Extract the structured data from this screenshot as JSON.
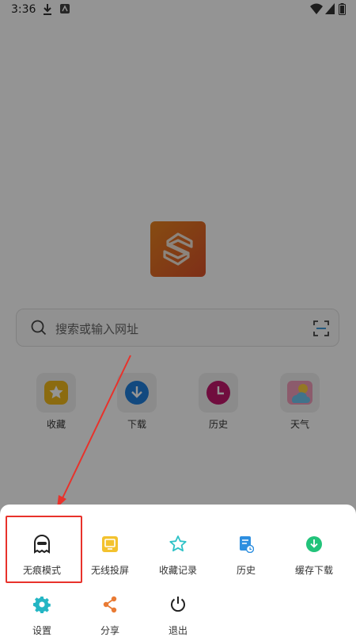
{
  "status_bar": {
    "time": "3:36"
  },
  "search": {
    "placeholder": "搜索或输入网址"
  },
  "shortcuts": [
    {
      "label": "收藏",
      "icon": "star-icon",
      "color": "#f0b81d"
    },
    {
      "label": "下载",
      "icon": "download-icon",
      "color": "#1f7fdb"
    },
    {
      "label": "历史",
      "icon": "clock-icon",
      "color": "#c2186c"
    },
    {
      "label": "天气",
      "icon": "weather-icon",
      "color": "#f19dbb"
    }
  ],
  "menu": {
    "row1": [
      {
        "label": "无痕模式",
        "icon": "ghost-icon"
      },
      {
        "label": "无线投屏",
        "icon": "cast-icon"
      },
      {
        "label": "收藏记录",
        "icon": "star-outline-icon"
      },
      {
        "label": "历史",
        "icon": "history-doc-icon"
      },
      {
        "label": "缓存下载",
        "icon": "download-circle-icon"
      }
    ],
    "row2": [
      {
        "label": "设置",
        "icon": "gear-icon"
      },
      {
        "label": "分享",
        "icon": "share-icon"
      },
      {
        "label": "退出",
        "icon": "power-icon"
      }
    ]
  },
  "colors": {
    "accent_red": "#e8322b",
    "logo_orange": "#e07226"
  }
}
